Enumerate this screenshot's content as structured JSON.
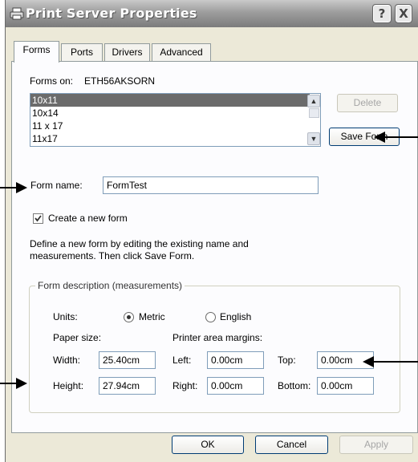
{
  "window": {
    "title": "Print Server Properties",
    "help_label": "?",
    "close_label": "X"
  },
  "tabs": [
    {
      "label": "Forms",
      "active": true
    },
    {
      "label": "Ports",
      "active": false
    },
    {
      "label": "Drivers",
      "active": false
    },
    {
      "label": "Advanced",
      "active": false
    }
  ],
  "forms_on": {
    "label": "Forms on:",
    "server": "ETH56AKSORN"
  },
  "forms_list": {
    "items": [
      "10x11",
      "10x14",
      "11 x 17",
      "11x17"
    ],
    "selected_index": 0
  },
  "buttons": {
    "delete": "Delete",
    "save_form": "Save Form",
    "ok": "OK",
    "cancel": "Cancel",
    "apply": "Apply"
  },
  "form_name": {
    "label": "Form name:",
    "value": "FormTest"
  },
  "create_new_form": {
    "label": "Create a new form",
    "checked": true
  },
  "instructions": {
    "line1": "Define a new form by editing the existing name and",
    "line2": "measurements.  Then click Save Form."
  },
  "form_description": {
    "legend": "Form description (measurements)",
    "units_label": "Units:",
    "metric_label": "Metric",
    "english_label": "English",
    "selected_unit": "Metric",
    "paper_size_label": "Paper size:",
    "printer_margins_label": "Printer area margins:",
    "width_label": "Width:",
    "width_value": "25.40cm",
    "height_label": "Height:",
    "height_value": "27.94cm",
    "left_label": "Left:",
    "left_value": "0.00cm",
    "right_label": "Right:",
    "right_value": "0.00cm",
    "top_label": "Top:",
    "top_value": "0.00cm",
    "bottom_label": "Bottom:",
    "bottom_value": "0.00cm"
  },
  "colors": {
    "title_bar": "#8f8f8f",
    "dialog_bg": "#ece9d8",
    "panel_bg": "#fcfcfe",
    "selection": "#6b6b6b"
  }
}
